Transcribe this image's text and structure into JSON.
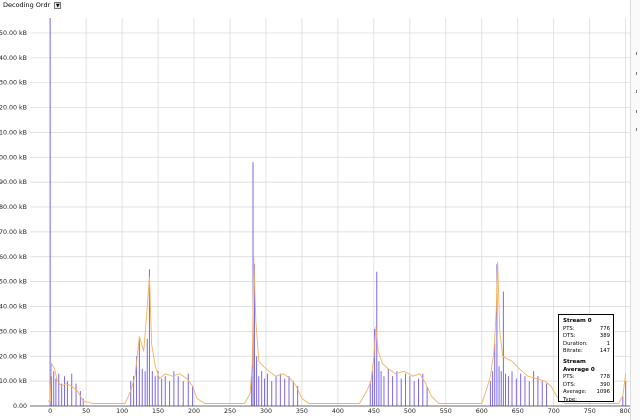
{
  "toolbar": {
    "mode_select": {
      "value": "Decoding Ordr"
    }
  },
  "chart_data": {
    "type": "bar",
    "title": "",
    "xlabel": "",
    "ylabel": "",
    "xlim": [
      -28,
      806
    ],
    "ylim": [
      0,
      156
    ],
    "x_ticks": [
      0,
      50,
      100,
      150,
      200,
      250,
      300,
      350,
      400,
      450,
      500,
      550,
      600,
      650,
      700,
      750,
      800
    ],
    "y_ticks": [
      "0.00",
      "10.00 kB",
      "20.00 kB",
      "30.00 kB",
      "40.00 kB",
      "50.00 kB",
      "60.00 kB",
      "70.00 kB",
      "80.00 kB",
      "90.00 kB",
      "100.00 kB",
      "110.00 kB",
      "120.00 kB",
      "130.00 kB",
      "140.00 kB",
      "150.00 kB"
    ],
    "y_tick_values": [
      0,
      10,
      20,
      30,
      40,
      50,
      60,
      70,
      80,
      90,
      100,
      110,
      120,
      130,
      140,
      150
    ],
    "grid": true,
    "colors": {
      "packets": "#7b68e6",
      "average": "#f7b15a",
      "grid": "#d6d6d6",
      "axis": "#444444"
    },
    "series": [
      {
        "kind": "packet_size_bars",
        "points": [
          [
            0,
            156
          ],
          [
            2,
            12
          ],
          [
            5,
            14
          ],
          [
            8,
            11
          ],
          [
            12,
            13
          ],
          [
            16,
            9
          ],
          [
            20,
            12
          ],
          [
            24,
            10
          ],
          [
            30,
            13
          ],
          [
            36,
            9
          ],
          [
            42,
            6
          ],
          [
            46,
            3
          ],
          [
            112,
            10
          ],
          [
            116,
            12
          ],
          [
            120,
            20
          ],
          [
            124,
            27
          ],
          [
            128,
            15
          ],
          [
            132,
            14
          ],
          [
            135,
            27
          ],
          [
            138,
            55
          ],
          [
            142,
            14
          ],
          [
            146,
            12
          ],
          [
            150,
            14
          ],
          [
            155,
            11
          ],
          [
            160,
            12
          ],
          [
            166,
            10
          ],
          [
            172,
            14
          ],
          [
            178,
            12
          ],
          [
            185,
            10
          ],
          [
            192,
            13
          ],
          [
            198,
            8
          ],
          [
            280,
            12
          ],
          [
            282,
            98
          ],
          [
            284,
            57
          ],
          [
            287,
            20
          ],
          [
            290,
            12
          ],
          [
            294,
            14
          ],
          [
            298,
            11
          ],
          [
            302,
            13
          ],
          [
            308,
            10
          ],
          [
            314,
            12
          ],
          [
            320,
            13
          ],
          [
            326,
            11
          ],
          [
            332,
            12
          ],
          [
            338,
            10
          ],
          [
            344,
            8
          ],
          [
            445,
            10
          ],
          [
            448,
            14
          ],
          [
            451,
            31
          ],
          [
            454,
            54
          ],
          [
            457,
            18
          ],
          [
            460,
            14
          ],
          [
            464,
            12
          ],
          [
            470,
            15
          ],
          [
            476,
            12
          ],
          [
            482,
            14
          ],
          [
            488,
            11
          ],
          [
            494,
            13
          ],
          [
            500,
            12
          ],
          [
            506,
            10
          ],
          [
            512,
            11
          ],
          [
            518,
            13
          ],
          [
            524,
            8
          ],
          [
            612,
            10
          ],
          [
            615,
            14
          ],
          [
            618,
            25
          ],
          [
            621,
            57
          ],
          [
            624,
            16
          ],
          [
            627,
            14
          ],
          [
            630,
            46
          ],
          [
            633,
            13
          ],
          [
            637,
            12
          ],
          [
            642,
            14
          ],
          [
            648,
            11
          ],
          [
            654,
            13
          ],
          [
            660,
            12
          ],
          [
            666,
            10
          ],
          [
            672,
            14
          ],
          [
            678,
            12
          ],
          [
            684,
            10
          ],
          [
            690,
            9
          ],
          [
            796,
            4
          ],
          [
            800,
            10
          ]
        ]
      },
      {
        "kind": "stream_average_line",
        "points": [
          [
            -3,
            2
          ],
          [
            0,
            2
          ],
          [
            2,
            17
          ],
          [
            6,
            15
          ],
          [
            10,
            10
          ],
          [
            16,
            8
          ],
          [
            22,
            9
          ],
          [
            30,
            8
          ],
          [
            38,
            6
          ],
          [
            46,
            2
          ],
          [
            60,
            1
          ],
          [
            104,
            1
          ],
          [
            112,
            6
          ],
          [
            118,
            12
          ],
          [
            124,
            28
          ],
          [
            130,
            22
          ],
          [
            135,
            40
          ],
          [
            138,
            52
          ],
          [
            141,
            25
          ],
          [
            146,
            16
          ],
          [
            152,
            11
          ],
          [
            160,
            13
          ],
          [
            170,
            12
          ],
          [
            180,
            13
          ],
          [
            190,
            11
          ],
          [
            198,
            8
          ],
          [
            204,
            3
          ],
          [
            215,
            1
          ],
          [
            270,
            1
          ],
          [
            278,
            5
          ],
          [
            281,
            17
          ],
          [
            283,
            60
          ],
          [
            286,
            34
          ],
          [
            290,
            18
          ],
          [
            296,
            16
          ],
          [
            304,
            14
          ],
          [
            314,
            12
          ],
          [
            324,
            13
          ],
          [
            334,
            11
          ],
          [
            342,
            8
          ],
          [
            350,
            3
          ],
          [
            360,
            1
          ],
          [
            430,
            1
          ],
          [
            440,
            6
          ],
          [
            446,
            10
          ],
          [
            450,
            20
          ],
          [
            453,
            32
          ],
          [
            456,
            22
          ],
          [
            462,
            17
          ],
          [
            470,
            15
          ],
          [
            480,
            13
          ],
          [
            492,
            14
          ],
          [
            504,
            12
          ],
          [
            514,
            13
          ],
          [
            522,
            9
          ],
          [
            530,
            4
          ],
          [
            540,
            1
          ],
          [
            600,
            1
          ],
          [
            607,
            7
          ],
          [
            612,
            12
          ],
          [
            617,
            22
          ],
          [
            620,
            38
          ],
          [
            622,
            58
          ],
          [
            625,
            30
          ],
          [
            629,
            20
          ],
          [
            635,
            19
          ],
          [
            642,
            18
          ],
          [
            652,
            15
          ],
          [
            664,
            12
          ],
          [
            676,
            11
          ],
          [
            688,
            10
          ],
          [
            696,
            8
          ],
          [
            704,
            4
          ],
          [
            715,
            1
          ],
          [
            790,
            1
          ],
          [
            796,
            4
          ],
          [
            800,
            13
          ]
        ]
      }
    ]
  },
  "info_box": {
    "stream": {
      "title": "Stream 0",
      "rows": [
        {
          "label": "PTS:",
          "value": "776"
        },
        {
          "label": "DTS:",
          "value": "389"
        },
        {
          "label": "Duration:",
          "value": "1"
        },
        {
          "label": "Bitrate:",
          "value": "147"
        }
      ]
    },
    "average": {
      "title": "Stream Average 0",
      "rows": [
        {
          "label": "PTS:",
          "value": "778"
        },
        {
          "label": "DTS:",
          "value": "390"
        },
        {
          "label": "Average:",
          "value": "1096"
        },
        {
          "label": "Type:",
          "value": ""
        }
      ]
    }
  }
}
